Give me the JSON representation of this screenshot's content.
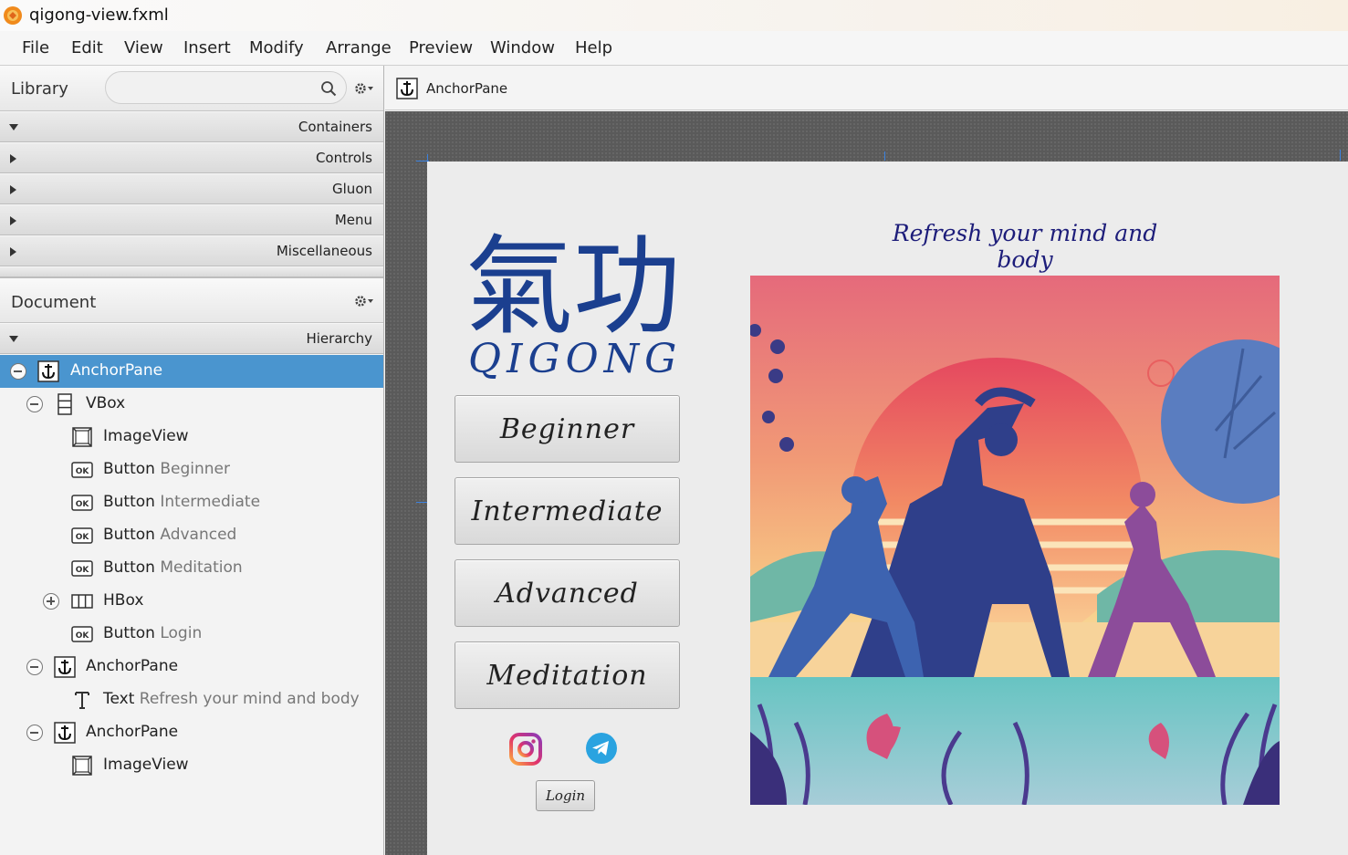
{
  "window": {
    "title": "qigong-view.fxml",
    "app_icon": "scene-builder-icon"
  },
  "menubar": [
    "File",
    "Edit",
    "View",
    "Insert",
    "Modify",
    "Arrange",
    "Preview",
    "Window",
    "Help"
  ],
  "library": {
    "title": "Library",
    "search_placeholder": "",
    "categories": [
      "Containers",
      "Controls",
      "Gluon",
      "Menu",
      "Miscellaneous"
    ]
  },
  "document": {
    "title": "Document",
    "section": "Hierarchy",
    "tree": [
      {
        "type": "AnchorPane",
        "detail": "",
        "icon": "anchor-icon",
        "expander": "minus",
        "selected": true
      },
      {
        "type": "VBox",
        "detail": "",
        "icon": "vbox-icon",
        "expander": "minus"
      },
      {
        "type": "ImageView",
        "detail": "",
        "icon": "imageview-icon"
      },
      {
        "type": "Button",
        "detail": "Beginner",
        "icon": "button-ok-icon"
      },
      {
        "type": "Button",
        "detail": "Intermediate",
        "icon": "button-ok-icon"
      },
      {
        "type": "Button",
        "detail": "Advanced",
        "icon": "button-ok-icon"
      },
      {
        "type": "Button",
        "detail": "Meditation",
        "icon": "button-ok-icon"
      },
      {
        "type": "HBox",
        "detail": "",
        "icon": "hbox-icon",
        "expander": "plus"
      },
      {
        "type": "Button",
        "detail": "Login",
        "icon": "button-ok-icon"
      },
      {
        "type": "AnchorPane",
        "detail": "",
        "icon": "anchor-icon",
        "expander": "minus"
      },
      {
        "type": "Text",
        "detail": "Refresh your mind and body",
        "icon": "text-icon"
      },
      {
        "type": "AnchorPane",
        "detail": "",
        "icon": "anchor-icon",
        "expander": "minus"
      },
      {
        "type": "ImageView",
        "detail": "",
        "icon": "imageview-icon"
      }
    ]
  },
  "content": {
    "breadcrumb": "AnchorPane",
    "logo": {
      "characters": "氣功",
      "latin": "QIGONG",
      "color": "#1b3f8f"
    },
    "buttons": [
      "Beginner",
      "Intermediate",
      "Advanced",
      "Meditation"
    ],
    "social": [
      "instagram-icon",
      "telegram-icon"
    ],
    "login": "Login",
    "tagline": "Refresh your mind and body",
    "accent": "#4a95cf",
    "tagline_color": "#1d1d7a"
  }
}
